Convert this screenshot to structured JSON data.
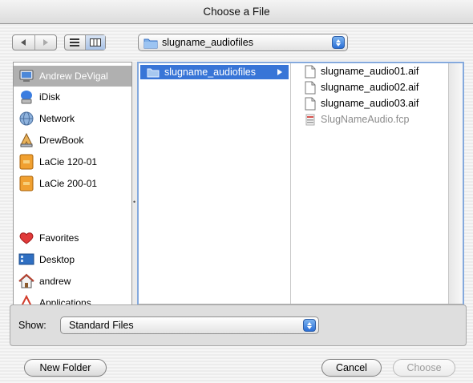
{
  "window": {
    "title": "Choose a File"
  },
  "toolbar": {
    "path_popup_label": "slugname_audiofiles"
  },
  "sidebar": {
    "items": [
      {
        "label": "Andrew DeVigal",
        "icon": "computer-icon",
        "selected": true
      },
      {
        "label": "iDisk",
        "icon": "idisk-icon"
      },
      {
        "label": "Network",
        "icon": "network-globe-icon"
      },
      {
        "label": "DrewBook",
        "icon": "drewbook-disk-icon"
      },
      {
        "label": "LaCie 120-01",
        "icon": "external-drive-icon"
      },
      {
        "label": "LaCie 200-01",
        "icon": "external-drive-icon"
      },
      {
        "label": "Favorites",
        "icon": "heart-icon"
      },
      {
        "label": "Desktop",
        "icon": "desktop-icon"
      },
      {
        "label": "andrew",
        "icon": "home-icon"
      },
      {
        "label": "Applications",
        "icon": "applications-icon"
      }
    ]
  },
  "browser": {
    "column1": {
      "selected_folder": "slugname_audiofiles"
    },
    "column2": {
      "files": [
        {
          "name": "slugname_audio01.aif",
          "enabled": true
        },
        {
          "name": "slugname_audio02.aif",
          "enabled": true
        },
        {
          "name": "slugname_audio03.aif",
          "enabled": true
        },
        {
          "name": "SlugNameAudio.fcp",
          "enabled": false
        }
      ]
    }
  },
  "show": {
    "label": "Show:",
    "value": "Standard Files"
  },
  "buttons": {
    "new_folder": "New Folder",
    "cancel": "Cancel",
    "choose": "Choose"
  },
  "colors": {
    "selection_blue": "#3875d7",
    "sidebar_selected_gray": "#b0b0b0",
    "focus_ring": "#84a9dd"
  }
}
